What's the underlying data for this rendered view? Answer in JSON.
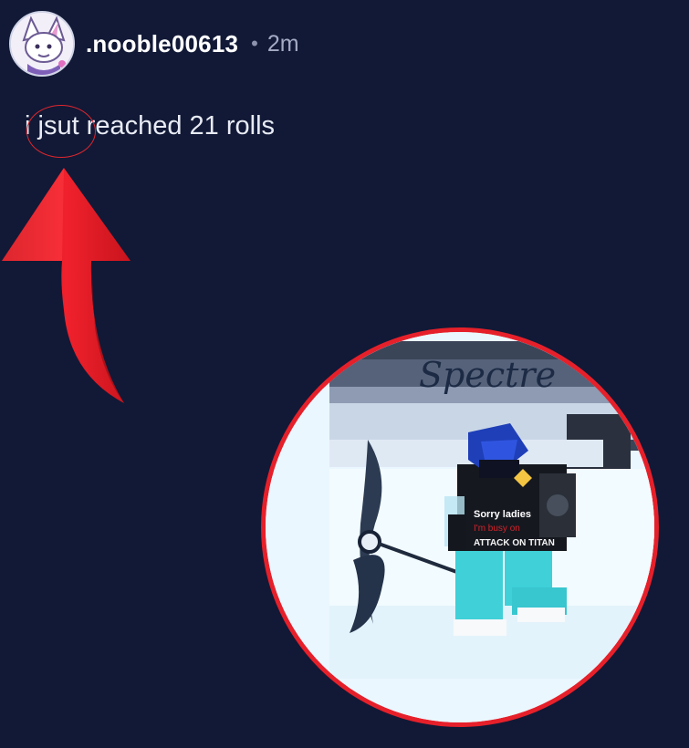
{
  "post": {
    "username": ".nooble00613",
    "separator": "•",
    "timestamp": "2m",
    "text": "i jsut reached 21 rolls"
  },
  "annotation": {
    "highlight_color": "#e1262d",
    "arrow_color": "#e6202a"
  },
  "image": {
    "title_text": "Spectre",
    "shirt_line1": "Sorry ladies",
    "shirt_line2": "I'm busy on",
    "shirt_line3": "ATTACK ON TITAN"
  },
  "colors": {
    "background": "#111936",
    "accent_red": "#e6202a"
  }
}
